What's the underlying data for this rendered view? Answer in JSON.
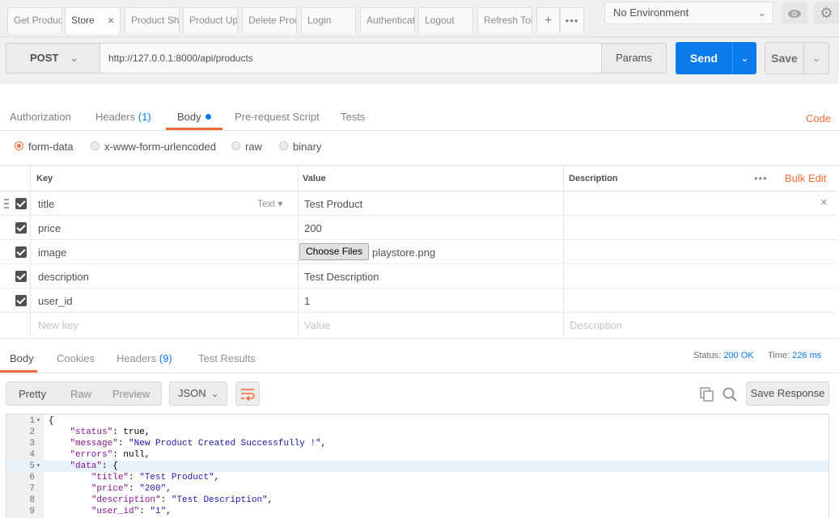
{
  "request_tabs": [
    {
      "label": "Get Product",
      "active": false
    },
    {
      "label": "Store",
      "active": true
    },
    {
      "label": "Product Sho",
      "active": false
    },
    {
      "label": "Product Upd",
      "active": false
    },
    {
      "label": "Delete Prod",
      "active": false
    },
    {
      "label": "Login",
      "active": false
    },
    {
      "label": "Authenticat",
      "active": false
    },
    {
      "label": "Logout",
      "active": false
    },
    {
      "label": "Refresh Tok",
      "active": false
    }
  ],
  "tab_controls": {
    "add": "+",
    "more": "•••",
    "close": "×"
  },
  "environment": {
    "selected": "No Environment",
    "chevron": "⌄"
  },
  "icons": {
    "eye": "eye-icon",
    "gear": "gear-icon",
    "copy": "copy-icon",
    "search": "search-icon",
    "wrap": "wrap-lines-icon",
    "drag": "drag-handle-icon"
  },
  "url_bar": {
    "method": "POST",
    "url": "http://127.0.0.1:8000/api/products",
    "params_label": "Params",
    "send_label": "Send",
    "save_label": "Save"
  },
  "request_subtabs": {
    "items": [
      {
        "label": "Authorization",
        "count": ""
      },
      {
        "label": "Headers",
        "count": "(1)"
      },
      {
        "label": "Body",
        "count": ""
      },
      {
        "label": "Pre-request Script",
        "count": ""
      },
      {
        "label": "Tests",
        "count": ""
      }
    ],
    "active": "Body",
    "code_link": "Code"
  },
  "body_types": {
    "options": [
      "form-data",
      "x-www-form-urlencoded",
      "raw",
      "binary"
    ],
    "selected": "form-data"
  },
  "form_table": {
    "headers": {
      "key": "Key",
      "value": "Value",
      "description": "Description",
      "more": "•••",
      "bulk_edit": "Bulk Edit"
    },
    "rows": [
      {
        "key": "title",
        "type": "Text ▾",
        "value": "Test Product",
        "checked": true
      },
      {
        "key": "price",
        "value": "200",
        "checked": true
      },
      {
        "key": "image",
        "file_button": "Choose Files",
        "file_name": "playstore.png",
        "checked": true
      },
      {
        "key": "description",
        "value": "Test Description",
        "checked": true
      },
      {
        "key": "user_id",
        "value": "1",
        "checked": true
      }
    ],
    "new_row": {
      "key_placeholder": "New key",
      "value_placeholder": "Value",
      "description_placeholder": "Description"
    }
  },
  "response": {
    "tabs": [
      {
        "label": "Body",
        "count": ""
      },
      {
        "label": "Cookies",
        "count": ""
      },
      {
        "label": "Headers",
        "count": "(9)"
      },
      {
        "label": "Test Results",
        "count": ""
      }
    ],
    "active_tab": "Body",
    "status_label": "Status:",
    "status_value": "200 OK",
    "time_label": "Time:",
    "time_value": "226 ms",
    "view_modes": [
      "Pretty",
      "Raw",
      "Preview"
    ],
    "active_view": "Pretty",
    "format": "JSON",
    "save_response_label": "Save Response"
  },
  "code_lines": [
    {
      "n": "1",
      "fold": "▾",
      "text": "{"
    },
    {
      "n": "2",
      "fold": "",
      "key": "\"status\"",
      "rest": ": true,"
    },
    {
      "n": "3",
      "fold": "",
      "key": "\"message\"",
      "str": "\"New Product Created Successfully !\"",
      "rest": ","
    },
    {
      "n": "4",
      "fold": "",
      "key": "\"errors\"",
      "rest": ": null,"
    },
    {
      "n": "5",
      "fold": "▾",
      "key": "\"data\"",
      "rest": ": {"
    },
    {
      "n": "6",
      "fold": "",
      "key": "\"title\"",
      "str": "\"Test Product\"",
      "rest": ","
    },
    {
      "n": "7",
      "fold": "",
      "key": "\"price\"",
      "str": "\"200\"",
      "rest": ","
    },
    {
      "n": "8",
      "fold": "",
      "key": "\"description\"",
      "str": "\"Test Description\"",
      "rest": ","
    },
    {
      "n": "9",
      "fold": "",
      "key": "\"user_id\"",
      "str": "\"1\"",
      "rest": ","
    }
  ],
  "colors": {
    "accent_orange": "#f26b3a",
    "accent_blue": "#097bed",
    "json_key": "#881391",
    "json_string": "#1a1aa6"
  }
}
